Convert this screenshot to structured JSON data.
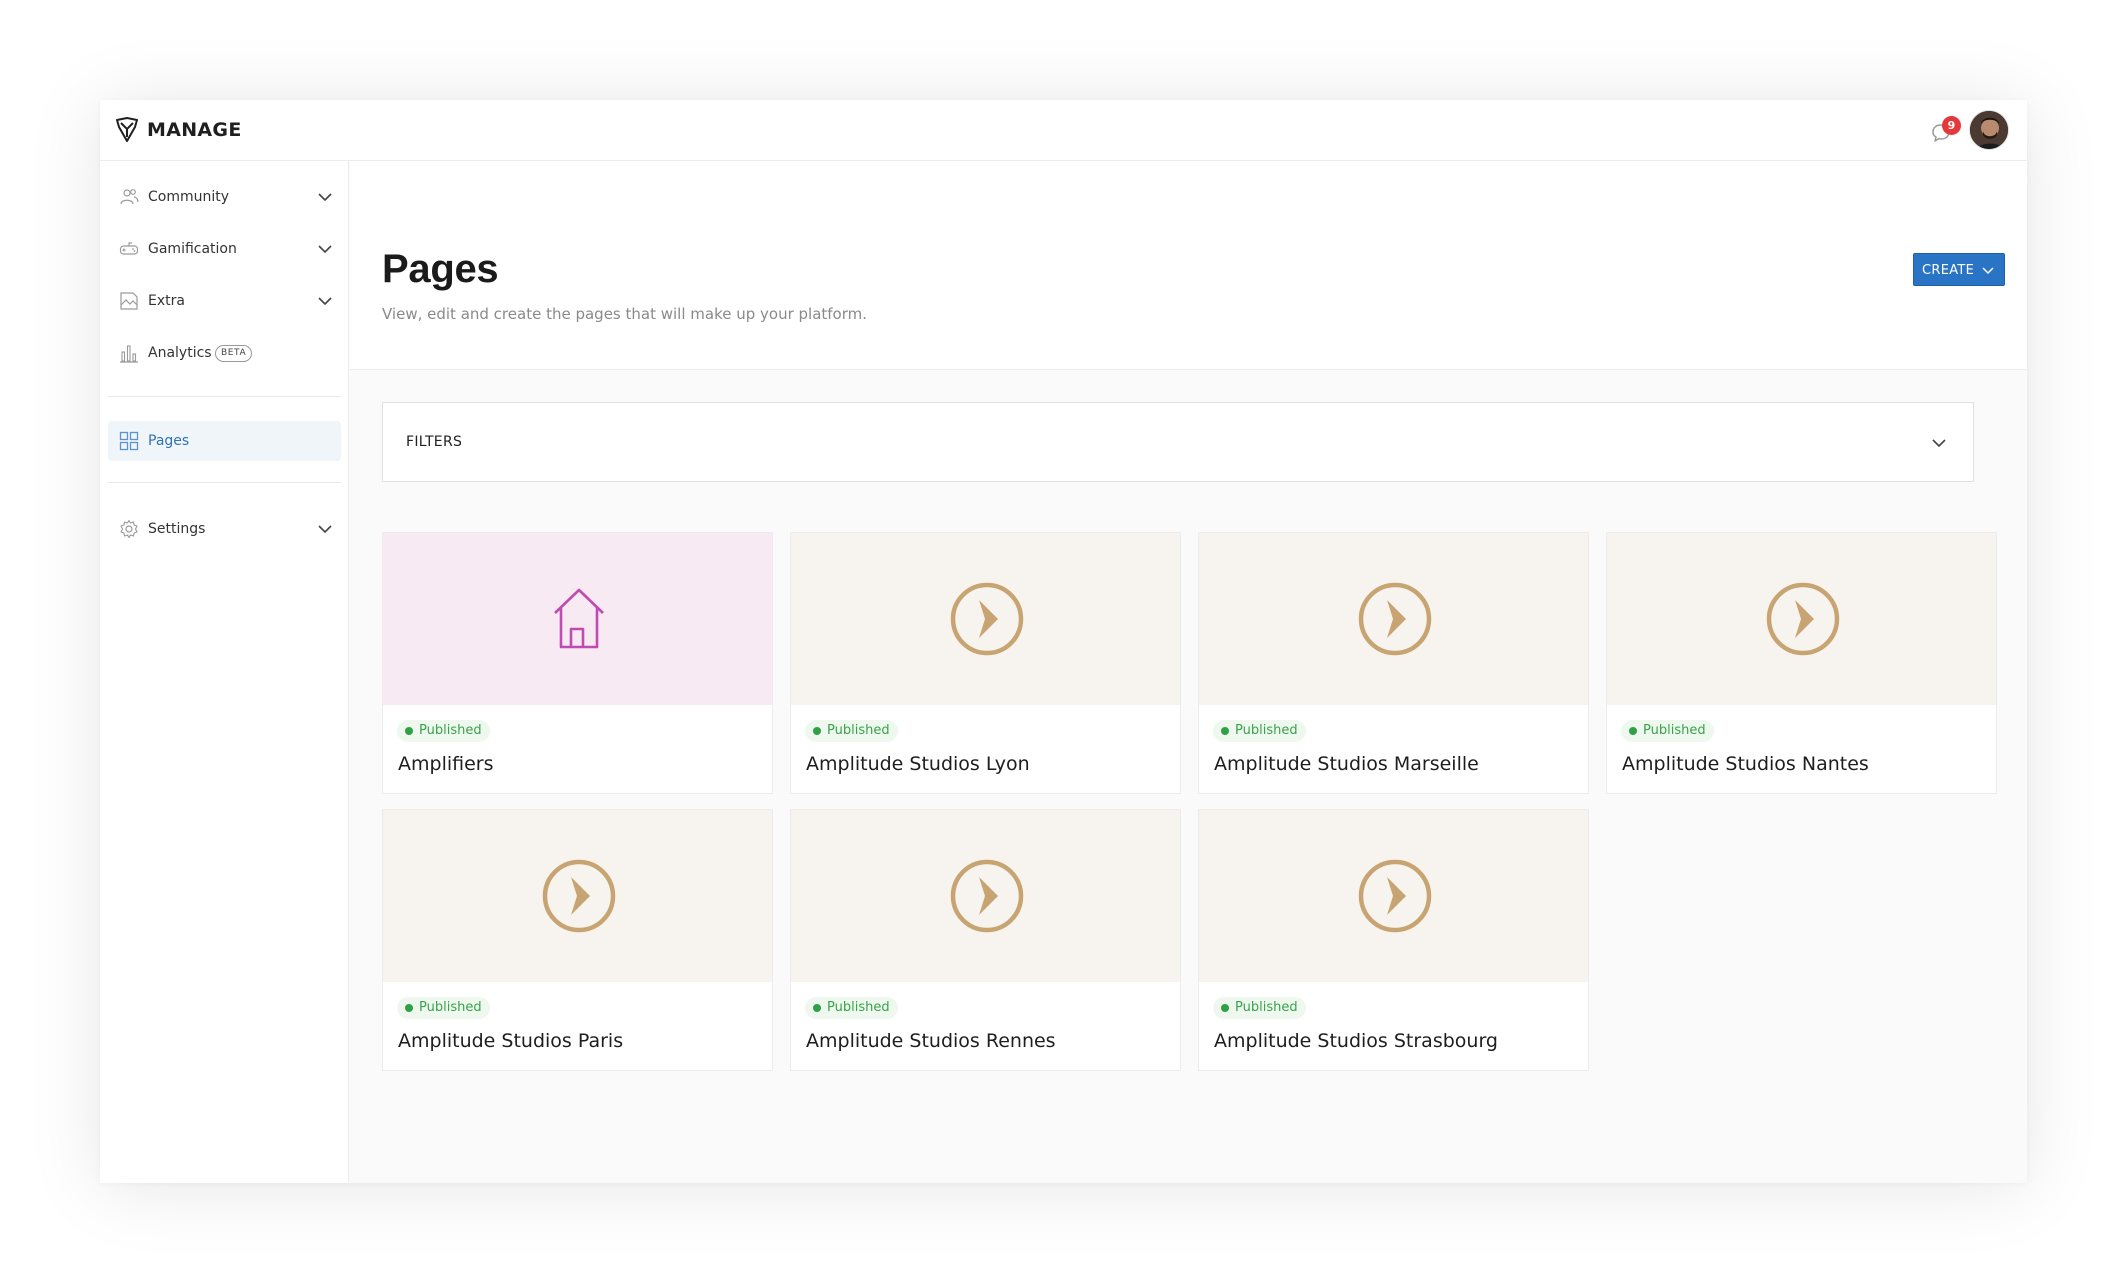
{
  "brand": {
    "name": "MANAGE",
    "logo_icon": "shield-logo-icon"
  },
  "notifications": {
    "count": "9",
    "icon": "chat-bubble-icon"
  },
  "user": {
    "avatar": "user-avatar"
  },
  "sidebar": {
    "items": [
      {
        "label": "Community",
        "icon": "community-icon",
        "expandable": true
      },
      {
        "label": "Gamification",
        "icon": "gamepad-icon",
        "expandable": true
      },
      {
        "label": "Extra",
        "icon": "extra-icon",
        "expandable": true
      },
      {
        "label": "Analytics",
        "icon": "bar-chart-icon",
        "badge": "BETA",
        "expandable": false
      },
      {
        "label": "Pages",
        "icon": "grid-icon",
        "active": true
      },
      {
        "label": "Settings",
        "icon": "gear-icon",
        "expandable": true
      }
    ]
  },
  "header": {
    "title": "Pages",
    "subtitle": "View, edit and create the pages that will make up your platform.",
    "create_label": "CREATE"
  },
  "filters": {
    "label": "FILTERS"
  },
  "cards": [
    {
      "title": "Amplifiers",
      "status": "Published",
      "icon": "home-icon"
    },
    {
      "title": "Amplitude Studios Lyon",
      "status": "Published",
      "icon": "arrow-circle-icon"
    },
    {
      "title": "Amplitude Studios Marseille",
      "status": "Published",
      "icon": "arrow-circle-icon"
    },
    {
      "title": "Amplitude Studios Nantes",
      "status": "Published",
      "icon": "arrow-circle-icon"
    },
    {
      "title": "Amplitude Studios Paris",
      "status": "Published",
      "icon": "arrow-circle-icon"
    },
    {
      "title": "Amplitude Studios Rennes",
      "status": "Published",
      "icon": "arrow-circle-icon"
    },
    {
      "title": "Amplitude Studios Strasbourg",
      "status": "Published",
      "icon": "arrow-circle-icon"
    }
  ],
  "colors": {
    "accent": "#2a74c6",
    "published": "#3aa24a",
    "home_icon": "#c04bb2",
    "page_icon": "#c8a472"
  }
}
